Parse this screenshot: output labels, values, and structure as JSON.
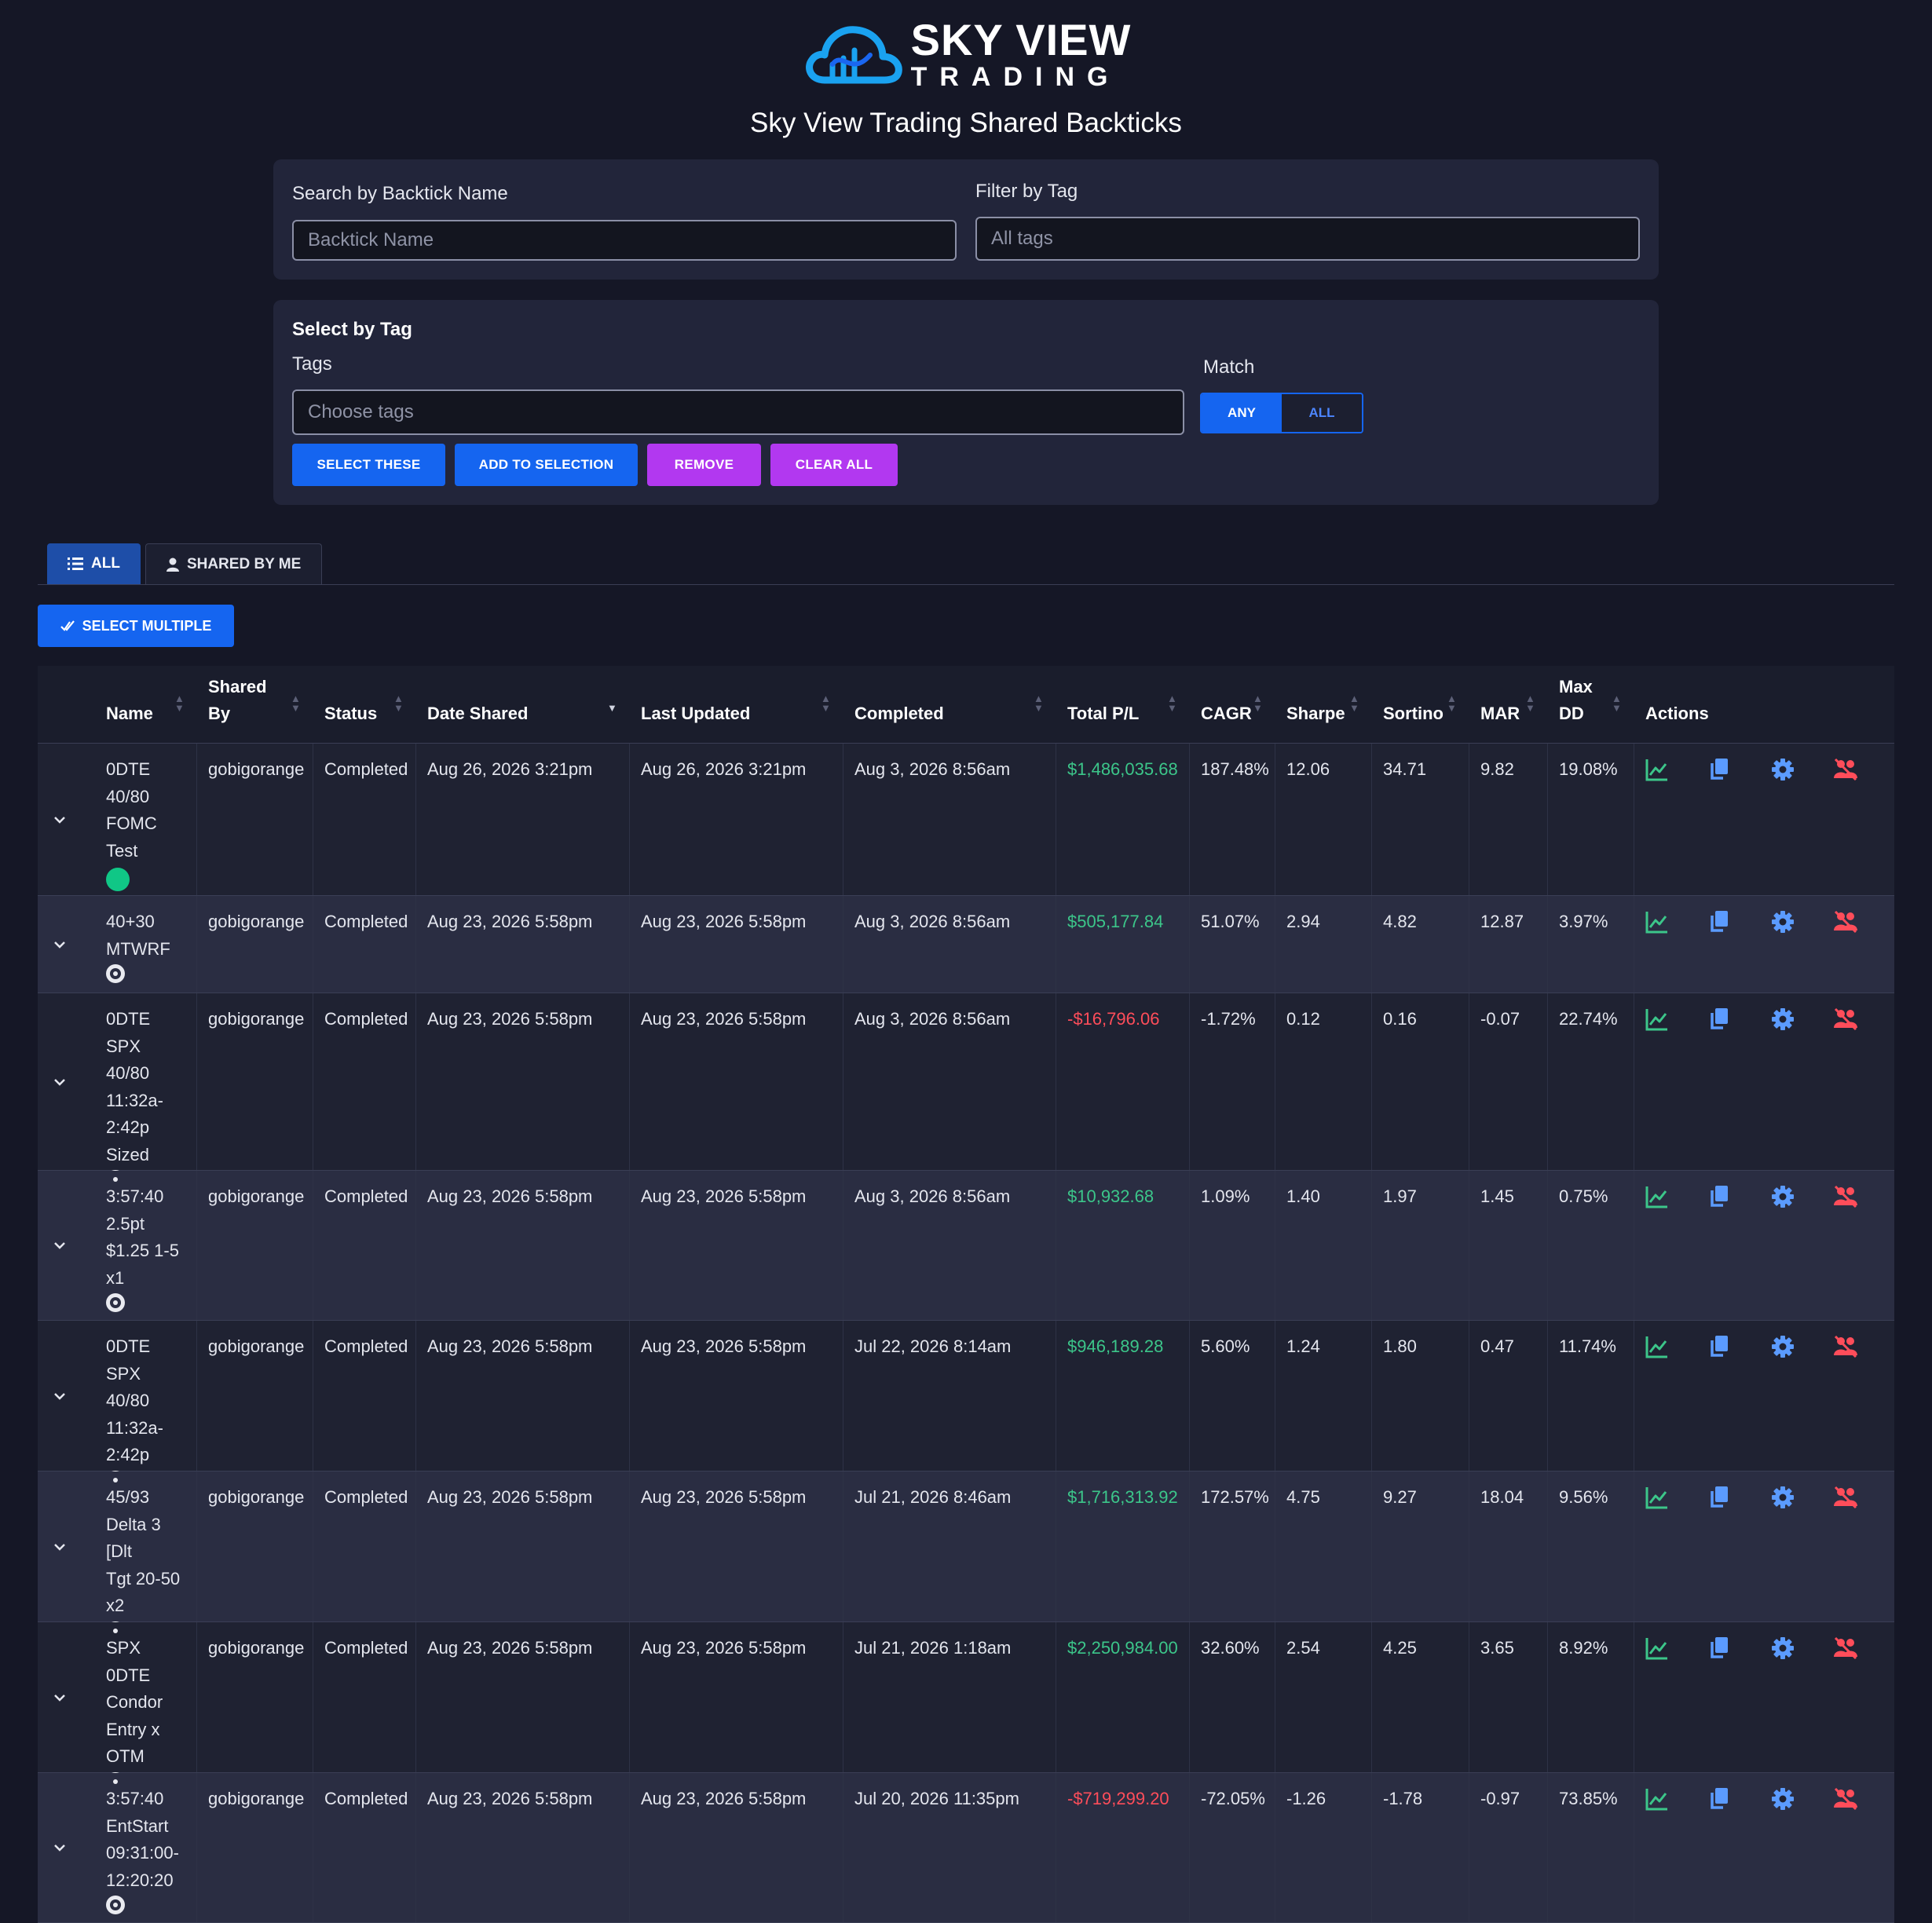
{
  "brand": {
    "logo_line1": "SKY VIEW",
    "logo_line2": "TRADING",
    "page_title": "Sky View Trading Shared Backticks"
  },
  "search": {
    "label": "Search by Backtick Name",
    "placeholder": "Backtick Name"
  },
  "filter": {
    "label": "Filter by Tag",
    "placeholder": "All tags"
  },
  "select_by_tag": {
    "title": "Select by Tag",
    "tags_label": "Tags",
    "tags_placeholder": "Choose tags",
    "match_label": "Match",
    "match_options": [
      "ANY",
      "ALL"
    ],
    "match_selected": "ANY",
    "buttons": {
      "select_these": "SELECT THESE",
      "add_to_selection": "ADD TO SELECTION",
      "remove": "REMOVE",
      "clear_all": "CLEAR ALL"
    }
  },
  "tabs": [
    {
      "label": "ALL",
      "icon": "list-icon",
      "active": true
    },
    {
      "label": "SHARED BY ME",
      "icon": "person-icon",
      "active": false
    }
  ],
  "select_multiple_label": "SELECT MULTIPLE",
  "colors": {
    "background": "#151726",
    "primary_button": "#1565f0",
    "secondary_button": "#b238f0",
    "positive": "#3cc68a",
    "negative": "#ff4d5a",
    "chart_icon": "#3cc68a",
    "copy_icon": "#5b9bff",
    "settings_icon": "#5b9bff",
    "unshare_icon": "#ff4d5a",
    "favorite_dot": "#10c786"
  },
  "table": {
    "headers": {
      "name": "Name",
      "shared_by": "Shared By",
      "status": "Status",
      "date_shared": "Date Shared",
      "last_updated": "Last Updated",
      "completed": "Completed",
      "total_pl": "Total P/L",
      "cagr": "CAGR",
      "sharpe": "Sharpe",
      "sortino": "Sortino",
      "mar": "MAR",
      "max_dd": "Max DD",
      "actions": "Actions"
    },
    "actions": [
      "chart-icon",
      "copy-icon",
      "settings-icon",
      "unshare-icon"
    ],
    "rows": [
      {
        "name": "0DTE 40/80 FOMC Test",
        "name_lines": [
          "0DTE",
          "40/80",
          "FOMC",
          "Test"
        ],
        "marker": "green",
        "shared_by": "gobigorange",
        "status": "Completed",
        "date_shared": "Aug 26, 2026 3:21pm",
        "last_updated": "Aug 26, 2026 3:21pm",
        "completed": "Aug 3, 2026 8:56am",
        "total_pl": "$1,486,035.68",
        "pl_sign": "pos",
        "cagr": "187.48%",
        "sharpe": "12.06",
        "sortino": "34.71",
        "mar": "9.82",
        "max_dd": "19.08%"
      },
      {
        "name": "40+30 MTWRF",
        "name_lines": [
          "40+30",
          "MTWRF"
        ],
        "marker": "radio",
        "shared_by": "gobigorange",
        "status": "Completed",
        "date_shared": "Aug 23, 2026 5:58pm",
        "last_updated": "Aug 23, 2026 5:58pm",
        "completed": "Aug 3, 2026 8:56am",
        "total_pl": "$505,177.84",
        "pl_sign": "pos",
        "cagr": "51.07%",
        "sharpe": "2.94",
        "sortino": "4.82",
        "mar": "12.87",
        "max_dd": "3.97%"
      },
      {
        "name": "0DTE SPX 40/80 11:32a-2:42p Sized",
        "name_lines": [
          "0DTE SPX",
          "40/80",
          "11:32a-",
          "2:42p",
          "Sized"
        ],
        "marker": "radio",
        "shared_by": "gobigorange",
        "status": "Completed",
        "date_shared": "Aug 23, 2026 5:58pm",
        "last_updated": "Aug 23, 2026 5:58pm",
        "completed": "Aug 3, 2026 8:56am",
        "total_pl": "-$16,796.06",
        "pl_sign": "neg",
        "cagr": "-1.72%",
        "sharpe": "0.12",
        "sortino": "0.16",
        "mar": "-0.07",
        "max_dd": "22.74%"
      },
      {
        "name": "3:57:40 2.5pt $1.25 1-5 x1",
        "name_lines": [
          "3:57:40",
          "2.5pt",
          "$1.25 1-5",
          "x1"
        ],
        "marker": "radio",
        "shared_by": "gobigorange",
        "status": "Completed",
        "date_shared": "Aug 23, 2026 5:58pm",
        "last_updated": "Aug 23, 2026 5:58pm",
        "completed": "Aug 3, 2026 8:56am",
        "total_pl": "$10,932.68",
        "pl_sign": "pos",
        "cagr": "1.09%",
        "sharpe": "1.40",
        "sortino": "1.97",
        "mar": "1.45",
        "max_dd": "0.75%"
      },
      {
        "name": "0DTE SPX 40/80 11:32a-2:42p",
        "name_lines": [
          "0DTE SPX",
          "40/80",
          "11:32a-",
          "2:42p"
        ],
        "marker": "radio",
        "shared_by": "gobigorange",
        "status": "Completed",
        "date_shared": "Aug 23, 2026 5:58pm",
        "last_updated": "Aug 23, 2026 5:58pm",
        "completed": "Jul 22, 2026 8:14am",
        "total_pl": "$946,189.28",
        "pl_sign": "pos",
        "cagr": "5.60%",
        "sharpe": "1.24",
        "sortino": "1.80",
        "mar": "0.47",
        "max_dd": "11.74%"
      },
      {
        "name": "45/93 Delta 3 [Dlt Tgt 20-50 x2",
        "name_lines": [
          "45/93",
          "Delta 3 [Dlt",
          "Tgt 20-50",
          "x2"
        ],
        "marker": "radio",
        "shared_by": "gobigorange",
        "status": "Completed",
        "date_shared": "Aug 23, 2026 5:58pm",
        "last_updated": "Aug 23, 2026 5:58pm",
        "completed": "Jul 21, 2026 8:46am",
        "total_pl": "$1,716,313.92",
        "pl_sign": "pos",
        "cagr": "172.57%",
        "sharpe": "4.75",
        "sortino": "9.27",
        "mar": "18.04",
        "max_dd": "9.56%"
      },
      {
        "name": "SPX 0DTE Condor Entry x OTM",
        "name_lines": [
          "SPX 0DTE",
          "Condor",
          "Entry x",
          "OTM"
        ],
        "marker": "radio",
        "shared_by": "gobigorange",
        "status": "Completed",
        "date_shared": "Aug 23, 2026 5:58pm",
        "last_updated": "Aug 23, 2026 5:58pm",
        "completed": "Jul 21, 2026 1:18am",
        "total_pl": "$2,250,984.00",
        "pl_sign": "pos",
        "cagr": "32.60%",
        "sharpe": "2.54",
        "sortino": "4.25",
        "mar": "3.65",
        "max_dd": "8.92%"
      },
      {
        "name": "3:57:40 EntStart 09:31:00-12:20:20",
        "name_lines": [
          "3:57:40",
          "EntStart",
          "09:31:00-",
          "12:20:20"
        ],
        "marker": "radio",
        "shared_by": "gobigorange",
        "status": "Completed",
        "date_shared": "Aug 23, 2026 5:58pm",
        "last_updated": "Aug 23, 2026 5:58pm",
        "completed": "Jul 20, 2026 11:35pm",
        "total_pl": "-$719,299.20",
        "pl_sign": "neg",
        "cagr": "-72.05%",
        "sharpe": "-1.26",
        "sortino": "-1.78",
        "mar": "-0.97",
        "max_dd": "73.85%"
      }
    ]
  }
}
